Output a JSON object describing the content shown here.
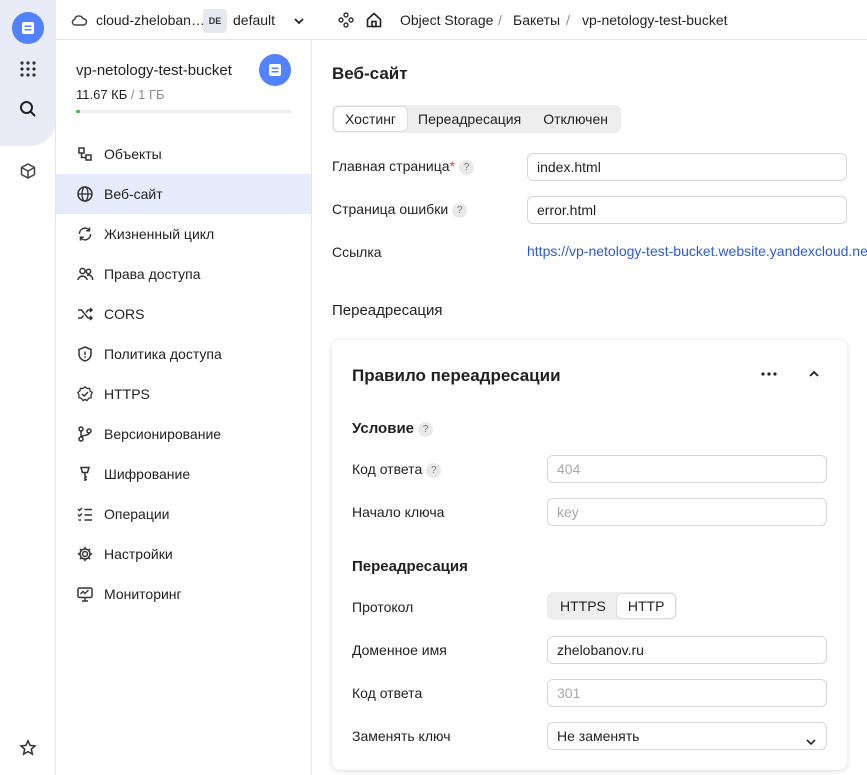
{
  "topbar": {
    "cloud_name": "cloud-zheloban…",
    "folder_badge": "DE",
    "folder_name": "default",
    "breadcrumb": [
      "Object Storage",
      "Бакеты",
      "vp-netology-test-bucket"
    ]
  },
  "bucket": {
    "name": "vp-netology-test-bucket",
    "used": "11.67 КБ",
    "limit": " / 1 ГБ",
    "usage_fraction": 0.01
  },
  "nav": [
    {
      "label": "Объекты",
      "icon": "objects-icon"
    },
    {
      "label": "Веб-сайт",
      "icon": "globe-icon",
      "active": true
    },
    {
      "label": "Жизненный цикл",
      "icon": "lifecycle-icon"
    },
    {
      "label": "Права доступа",
      "icon": "users-icon"
    },
    {
      "label": "CORS",
      "icon": "shuffle-icon"
    },
    {
      "label": "Политика доступа",
      "icon": "shield-icon"
    },
    {
      "label": "HTTPS",
      "icon": "badge-check-icon"
    },
    {
      "label": "Версионирование",
      "icon": "branch-icon"
    },
    {
      "label": "Шифрование",
      "icon": "key-icon"
    },
    {
      "label": "Операции",
      "icon": "list-icon"
    },
    {
      "label": "Настройки",
      "icon": "gear-icon"
    },
    {
      "label": "Мониторинг",
      "icon": "monitor-icon"
    }
  ],
  "website": {
    "title": "Веб-сайт",
    "tabs": [
      "Хостинг",
      "Переадресация",
      "Отключен"
    ],
    "selected_tab": "Хостинг",
    "main_page_label": "Главная страница",
    "main_page_value": "index.html",
    "error_page_label": "Страница ошибки",
    "error_page_value": "error.html",
    "link_label": "Ссылка",
    "link_value": "https://vp-netology-test-bucket.website.yandexcloud.net",
    "redirect_section": "Переадресация"
  },
  "rule": {
    "title": "Правило переадресации",
    "condition_heading": "Условие",
    "response_code_label": "Код ответа",
    "response_code_placeholder": "404",
    "key_prefix_label": "Начало ключа",
    "key_prefix_placeholder": "key",
    "redirect_heading": "Переадресация",
    "protocol_label": "Протокол",
    "protocol_options": [
      "HTTPS",
      "HTTP"
    ],
    "protocol_selected": "HTTP",
    "domain_label": "Доменное имя",
    "domain_value": "zhelobanov.ru",
    "redirect_code_label": "Код ответа",
    "redirect_code_placeholder": "301",
    "replace_key_label": "Заменять ключ",
    "replace_key_value": "Не заменять"
  },
  "colors": {
    "accent": "#5282ff",
    "link": "#2f5bd1",
    "active_nav": "#e6ecfb",
    "required": "#e5343f",
    "usage": "#3fb83f"
  }
}
